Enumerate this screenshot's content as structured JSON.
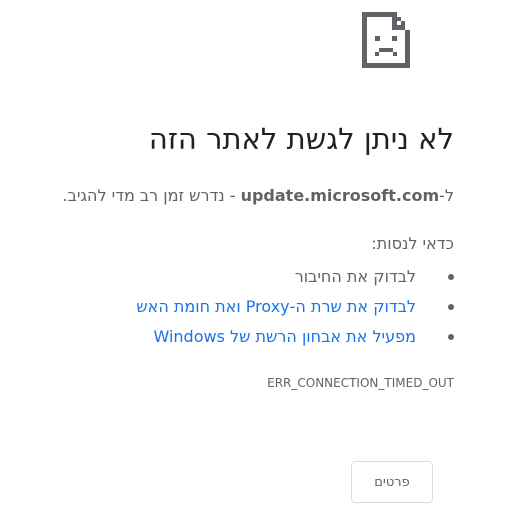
{
  "error_page": {
    "icon": "sad-page-icon",
    "title": "לא ניתן לגשת לאתר הזה",
    "subtitle_prefix": "ל-",
    "host": "update.microsoft.com",
    "subtitle_suffix": "- נדרש זמן רב מדי להגיב.",
    "try_label": "כדאי לנסות:",
    "suggestions": [
      {
        "text": "לבדוק את החיבור",
        "is_link": false
      },
      {
        "text": "לבדוק את שרת ה-Proxy ואת חומת האש",
        "is_link": true
      },
      {
        "text": "מפעיל את אבחון הרשת של Windows",
        "is_link": true
      }
    ],
    "error_code": "ERR_CONNECTION_TIMED_OUT",
    "details_button": "פרטים"
  },
  "colors": {
    "text": "#5f6368",
    "title": "#202124",
    "link": "#1a73e8",
    "icon": "#5f6368",
    "button_border": "#dadce0"
  }
}
